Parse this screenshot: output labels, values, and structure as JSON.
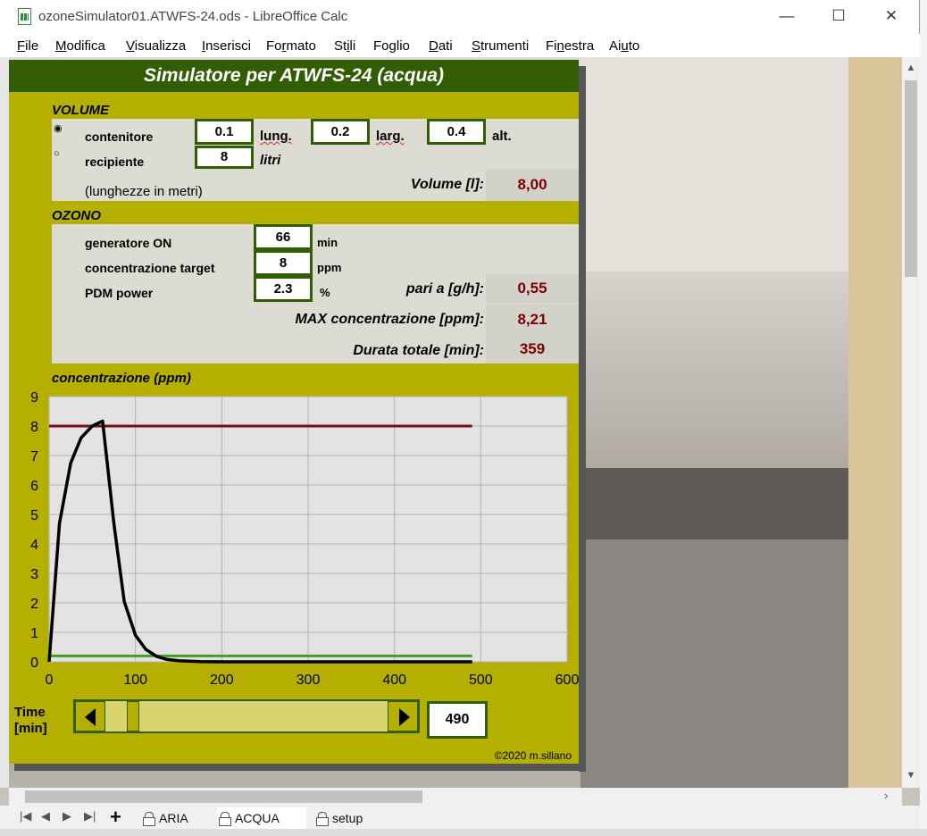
{
  "window": {
    "title": "ozoneSimulator01.ATWFS-24.ods - LibreOffice Calc",
    "controls": {
      "minimize": "—",
      "maximize": "☐",
      "close": "✕"
    }
  },
  "menu": [
    {
      "label": "File",
      "u": "F"
    },
    {
      "label": "Modifica",
      "u": "M"
    },
    {
      "label": "Visualizza",
      "u": "V"
    },
    {
      "label": "Inserisci",
      "u": "I"
    },
    {
      "label": "Formato",
      "u": "r"
    },
    {
      "label": "Stili",
      "u": "i"
    },
    {
      "label": "Foglio",
      "u": "g"
    },
    {
      "label": "Dati",
      "u": "D"
    },
    {
      "label": "Strumenti",
      "u": "S"
    },
    {
      "label": "Finestra",
      "u": "n"
    },
    {
      "label": "Aiuto",
      "u": "u"
    }
  ],
  "panel": {
    "title": "Simulatore per ATWFS-24 (acqua)",
    "volume": {
      "section": "VOLUME",
      "contenitore": "contenitore",
      "recipiente": "recipiente",
      "lung_value": "0.1",
      "lung_unit": "lung.",
      "larg_value": "0.2",
      "larg_unit": "larg.",
      "alt_value": "0.4",
      "alt_unit": "alt.",
      "litri_value": "8",
      "litri_unit": "litri",
      "note": "(lunghezze in metri)",
      "result_label": "Volume [l]:",
      "result_value": "8,00"
    },
    "ozono": {
      "section": "OZONO",
      "generatore_label": "generatore ON",
      "generatore_value": "66",
      "generatore_unit": "min",
      "conc_label": "concentrazione target",
      "conc_value": "8",
      "conc_unit": "ppm",
      "pdm_label": "PDM power",
      "pdm_value": "2.3",
      "pdm_unit": "%",
      "pari_label": "pari a [g/h]:",
      "pari_value": "0,55",
      "max_label": "MAX concentrazione [ppm]:",
      "max_value": "8,21",
      "durata_label": "Durata totale [min]:",
      "durata_value": "359"
    },
    "chart_title": "concentrazione (ppm)",
    "time_label_1": "Time",
    "time_label_2": "[min]",
    "time_value": "490",
    "copyright": "©2020 m.sillano"
  },
  "chart_data": {
    "type": "line",
    "title": "concentrazione (ppm)",
    "xlim": [
      0,
      600
    ],
    "ylim": [
      0,
      9
    ],
    "xticks": [
      0,
      100,
      200,
      300,
      400,
      500,
      600
    ],
    "yticks": [
      0,
      1,
      2,
      3,
      4,
      5,
      6,
      7,
      8,
      9
    ],
    "grid": true,
    "series": [
      {
        "color": "#000000",
        "x": [
          0,
          12,
          25,
          37,
          50,
          62,
          75,
          87,
          100,
          112,
          125,
          137,
          150,
          175,
          200,
          300,
          400,
          490
        ],
        "y": [
          0,
          4.7,
          6.75,
          7.6,
          8.0,
          8.17,
          4.7,
          2.05,
          0.9,
          0.42,
          0.18,
          0.08,
          0.04,
          0.01,
          0,
          0,
          0,
          0
        ]
      },
      {
        "color": "#7a0a1e",
        "x": [
          0,
          490
        ],
        "y": [
          8,
          8
        ]
      },
      {
        "color": "#4a9a2a",
        "x": [
          0,
          490
        ],
        "y": [
          0.2,
          0.2
        ]
      }
    ]
  },
  "sheet_tabs": [
    "ARIA",
    "ACQUA",
    "setup"
  ],
  "active_tab": "ACQUA"
}
